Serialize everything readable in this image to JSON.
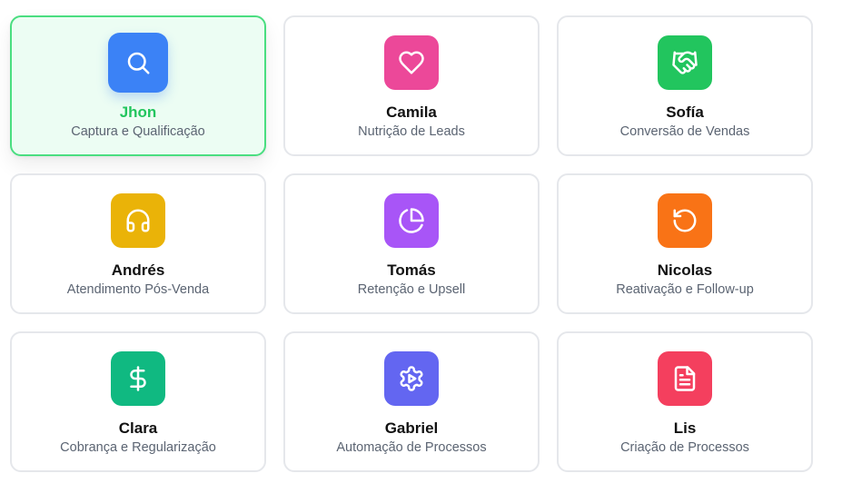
{
  "agents": [
    {
      "name": "Jhon",
      "role": "Captura e Qualificação",
      "icon": "search-icon",
      "color": "#3b82f6",
      "selected": true
    },
    {
      "name": "Camila",
      "role": "Nutrição de Leads",
      "icon": "heart-icon",
      "color": "#ec4899",
      "selected": false
    },
    {
      "name": "Sofía",
      "role": "Conversão de Vendas",
      "icon": "handshake-icon",
      "color": "#22c55e",
      "selected": false
    },
    {
      "name": "Andrés",
      "role": "Atendimento Pós-Venda",
      "icon": "headphones-icon",
      "color": "#eab308",
      "selected": false
    },
    {
      "name": "Tomás",
      "role": "Retenção e Upsell",
      "icon": "pie-chart-icon",
      "color": "#a855f7",
      "selected": false
    },
    {
      "name": "Nicolas",
      "role": "Reativação e Follow-up",
      "icon": "rotate-ccw-icon",
      "color": "#f97316",
      "selected": false
    },
    {
      "name": "Clara",
      "role": "Cobrança e Regularização",
      "icon": "dollar-sign-icon",
      "color": "#10b981",
      "selected": false
    },
    {
      "name": "Gabriel",
      "role": "Automação de Processos",
      "icon": "gear-play-icon",
      "color": "#6366f1",
      "selected": false
    },
    {
      "name": "Lis",
      "role": "Criação de Processos",
      "icon": "file-text-icon",
      "color": "#f43f5e",
      "selected": false
    }
  ]
}
